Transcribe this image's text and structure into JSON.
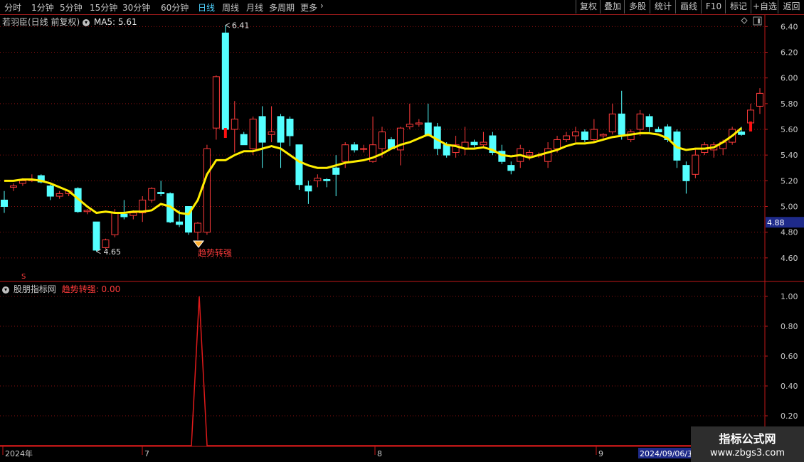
{
  "toolbar": {
    "tabs": [
      {
        "label": "分时",
        "active": false
      },
      {
        "label": "1分钟",
        "active": false
      },
      {
        "label": "5分钟",
        "active": false
      },
      {
        "label": "15分钟",
        "active": false
      },
      {
        "label": "30分钟",
        "active": false
      },
      {
        "label": "60分钟",
        "active": false
      },
      {
        "label": "日线",
        "active": true
      },
      {
        "label": "周线",
        "active": false
      },
      {
        "label": "月线",
        "active": false
      },
      {
        "label": "多周期",
        "active": false
      },
      {
        "label": "更多",
        "active": false
      }
    ],
    "more_icon": "chevron-right-icon",
    "right_buttons": [
      "复权",
      "叠加",
      "多股",
      "统计",
      "画线",
      "F10",
      "标记",
      "+自选",
      "返回"
    ]
  },
  "main_panel": {
    "title": "若羽臣(日线 前复权)",
    "ma_label": "MA5: 5.61",
    "y_ticks": [
      "6.40",
      "6.20",
      "6.00",
      "5.80",
      "5.60",
      "5.40",
      "5.20",
      "5.00",
      "4.80",
      "4.60"
    ],
    "current_price_tag": "4.88",
    "high_label": "6.41",
    "low_label": "4.65",
    "signal_label": "趋势转强",
    "signal_icon": "diamond-icon",
    "colors": {
      "up": "#ff3b3b",
      "down": "#54ffff",
      "ma": "#ffee00",
      "grid": "#8a1010",
      "axis": "#c01818"
    }
  },
  "sub_panel": {
    "title": "股朋指标网",
    "indicator_label": "趋势转强: 0.00",
    "y_ticks": [
      "1.00",
      "0.80",
      "0.60",
      "0.40",
      "0.20"
    ]
  },
  "x_axis": {
    "labels": [
      "2024年",
      "7",
      "8",
      "9"
    ],
    "cursor_date": "2024/09/06/五"
  },
  "watermark": {
    "line1": "指标公式网",
    "line2": "www.zbgs3.com"
  },
  "chart_data": [
    {
      "type": "candlestick",
      "title": "若羽臣(日线 前复权)",
      "ylim": [
        4.5,
        6.5
      ],
      "series_ma": {
        "name": "MA5",
        "last": 5.61
      },
      "annotations": [
        {
          "text": "6.41",
          "kind": "high"
        },
        {
          "text": "4.65",
          "kind": "low"
        },
        {
          "text": "趋势转强",
          "kind": "signal"
        }
      ],
      "candles": [
        [
          5.05,
          5.12,
          4.95,
          5.0
        ],
        [
          5.15,
          5.18,
          5.12,
          5.16
        ],
        [
          5.18,
          5.22,
          5.16,
          5.2
        ],
        [
          5.2,
          5.25,
          5.19,
          5.21
        ],
        [
          5.24,
          5.25,
          5.18,
          5.19
        ],
        [
          5.16,
          5.17,
          5.05,
          5.08
        ],
        [
          5.08,
          5.12,
          5.06,
          5.1
        ],
        [
          5.1,
          5.13,
          5.08,
          5.12
        ],
        [
          5.14,
          5.15,
          4.95,
          4.96
        ],
        [
          4.96,
          4.98,
          4.94,
          4.97
        ],
        [
          4.88,
          4.88,
          4.65,
          4.66
        ],
        [
          4.68,
          4.75,
          4.67,
          4.74
        ],
        [
          4.78,
          4.98,
          4.76,
          4.95
        ],
        [
          4.94,
          5.05,
          4.9,
          4.92
        ],
        [
          4.93,
          4.97,
          4.9,
          4.95
        ],
        [
          4.95,
          5.08,
          4.88,
          5.05
        ],
        [
          5.05,
          5.15,
          5.03,
          5.14
        ],
        [
          5.11,
          5.2,
          5.08,
          5.1
        ],
        [
          5.1,
          5.11,
          4.87,
          4.88
        ],
        [
          4.88,
          4.97,
          4.84,
          4.86
        ],
        [
          5.0,
          5.0,
          4.78,
          4.8
        ],
        [
          4.8,
          4.88,
          4.74,
          4.87
        ],
        [
          4.8,
          5.48,
          4.78,
          5.45
        ],
        [
          5.61,
          6.02,
          5.52,
          6.01
        ],
        [
          6.35,
          6.41,
          5.59,
          5.6
        ],
        [
          5.6,
          5.82,
          5.42,
          5.68
        ],
        [
          5.56,
          5.58,
          5.48,
          5.48
        ],
        [
          5.45,
          5.7,
          5.4,
          5.68
        ],
        [
          5.7,
          5.78,
          5.3,
          5.5
        ],
        [
          5.56,
          5.78,
          5.5,
          5.58
        ],
        [
          5.7,
          5.72,
          5.3,
          5.5
        ],
        [
          5.68,
          5.7,
          5.47,
          5.55
        ],
        [
          5.48,
          5.48,
          5.13,
          5.17
        ],
        [
          5.16,
          5.2,
          5.02,
          5.12
        ],
        [
          5.2,
          5.25,
          5.15,
          5.22
        ],
        [
          5.21,
          5.22,
          5.15,
          5.2
        ],
        [
          5.3,
          5.4,
          5.08,
          5.25
        ],
        [
          5.35,
          5.5,
          5.3,
          5.48
        ],
        [
          5.48,
          5.5,
          5.42,
          5.44
        ],
        [
          5.45,
          5.48,
          5.42,
          5.45
        ],
        [
          5.35,
          5.7,
          5.34,
          5.48
        ],
        [
          5.45,
          5.62,
          5.38,
          5.58
        ],
        [
          5.52,
          5.54,
          5.45,
          5.45
        ],
        [
          5.44,
          5.62,
          5.32,
          5.61
        ],
        [
          5.62,
          5.8,
          5.6,
          5.64
        ],
        [
          5.64,
          5.68,
          5.62,
          5.65
        ],
        [
          5.65,
          5.8,
          5.6,
          5.55
        ],
        [
          5.62,
          5.65,
          5.4,
          5.45
        ],
        [
          5.48,
          5.5,
          5.38,
          5.4
        ],
        [
          5.42,
          5.55,
          5.38,
          5.48
        ],
        [
          5.45,
          5.62,
          5.4,
          5.5
        ],
        [
          5.5,
          5.52,
          5.46,
          5.48
        ],
        [
          5.48,
          5.58,
          5.46,
          5.5
        ],
        [
          5.55,
          5.58,
          5.4,
          5.42
        ],
        [
          5.43,
          5.48,
          5.33,
          5.35
        ],
        [
          5.32,
          5.35,
          5.25,
          5.28
        ],
        [
          5.35,
          5.48,
          5.3,
          5.45
        ],
        [
          5.4,
          5.44,
          5.36,
          5.42
        ],
        [
          5.4,
          5.42,
          5.38,
          5.4
        ],
        [
          5.35,
          5.5,
          5.3,
          5.45
        ],
        [
          5.45,
          5.55,
          5.42,
          5.52
        ],
        [
          5.52,
          5.58,
          5.5,
          5.55
        ],
        [
          5.55,
          5.62,
          5.5,
          5.58
        ],
        [
          5.58,
          5.6,
          5.5,
          5.52
        ],
        [
          5.52,
          5.68,
          5.5,
          5.6
        ],
        [
          5.55,
          5.57,
          5.53,
          5.56
        ],
        [
          5.58,
          5.8,
          5.56,
          5.72
        ],
        [
          5.72,
          5.9,
          5.52,
          5.56
        ],
        [
          5.52,
          5.6,
          5.5,
          5.58
        ],
        [
          5.6,
          5.75,
          5.55,
          5.72
        ],
        [
          5.7,
          5.72,
          5.58,
          5.62
        ],
        [
          5.6,
          5.62,
          5.58,
          5.58
        ],
        [
          5.62,
          5.64,
          5.5,
          5.52
        ],
        [
          5.58,
          5.6,
          5.3,
          5.36
        ],
        [
          5.32,
          5.35,
          5.1,
          5.2
        ],
        [
          5.25,
          5.45,
          5.22,
          5.4
        ],
        [
          5.42,
          5.5,
          5.4,
          5.48
        ],
        [
          5.44,
          5.5,
          5.38,
          5.48
        ],
        [
          5.45,
          5.52,
          5.4,
          5.5
        ],
        [
          5.5,
          5.62,
          5.48,
          5.6
        ],
        [
          5.58,
          5.62,
          5.55,
          5.56
        ],
        [
          5.65,
          5.8,
          5.6,
          5.75
        ],
        [
          5.78,
          5.92,
          5.72,
          5.88
        ]
      ],
      "ma": [
        5.2,
        5.2,
        5.21,
        5.21,
        5.2,
        5.18,
        5.15,
        5.12,
        5.06,
        5.0,
        4.95,
        4.96,
        4.95,
        4.95,
        4.96,
        4.96,
        4.97,
        5.02,
        5.0,
        4.95,
        4.94,
        5.05,
        5.25,
        5.36,
        5.36,
        5.4,
        5.43,
        5.43,
        5.45,
        5.47,
        5.45,
        5.4,
        5.35,
        5.32,
        5.3,
        5.3,
        5.32,
        5.34,
        5.35,
        5.36,
        5.38,
        5.41,
        5.45,
        5.48,
        5.5,
        5.53,
        5.56,
        5.52,
        5.48,
        5.47,
        5.45,
        5.45,
        5.46,
        5.44,
        5.4,
        5.39,
        5.4,
        5.38,
        5.4,
        5.42,
        5.44,
        5.47,
        5.49,
        5.49,
        5.5,
        5.52,
        5.54,
        5.55,
        5.56,
        5.57,
        5.57,
        5.56,
        5.53,
        5.46,
        5.44,
        5.45,
        5.45,
        5.46,
        5.5,
        5.55,
        5.61
      ]
    },
    {
      "type": "line",
      "title": "股朋指标网",
      "series": [
        {
          "name": "趋势转强",
          "spike_index": 20,
          "value_at_spike": 1.0,
          "baseline": 0.0
        }
      ],
      "ylim": [
        0,
        1.1
      ]
    }
  ]
}
